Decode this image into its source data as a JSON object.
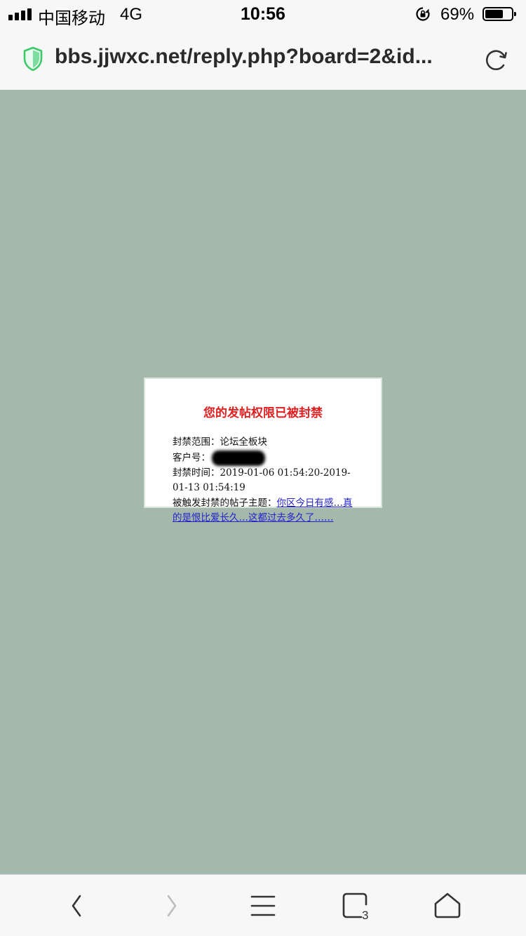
{
  "status_bar": {
    "carrier": "中国移动",
    "network": "4G",
    "time": "10:56",
    "battery_percent": "69%",
    "battery_level": 0.69,
    "signal_bars": 4
  },
  "address_bar": {
    "url": "bbs.jjwxc.net/reply.php?board=2&id...",
    "secure_icon": "shield-icon",
    "reload_icon": "reload-icon"
  },
  "notice": {
    "title": "您的发帖权限已被封禁",
    "scope_label": "封禁范围：",
    "scope_value": "论坛全板块",
    "client_label": "客户号：",
    "client_value_redacted": true,
    "time_label": "封禁时间：",
    "time_value": "2019-01-06 01:54:20-2019-01-13 01:54:19",
    "topic_label": "被触发封禁的帖子主题：",
    "topic_link": "你区今日有感…真的是恨比爱长久…这都过去多久了……"
  },
  "toolbar": {
    "back_icon": "back-icon",
    "forward_icon": "forward-icon",
    "menu_icon": "menu-icon",
    "tabs_icon": "tabs-icon",
    "tabs_count": "3",
    "home_icon": "home-icon"
  },
  "colors": {
    "page_background": "#a4b8ab",
    "notice_title": "#e02020",
    "link": "#2222cc",
    "secure_shield": "#3cc96a"
  }
}
